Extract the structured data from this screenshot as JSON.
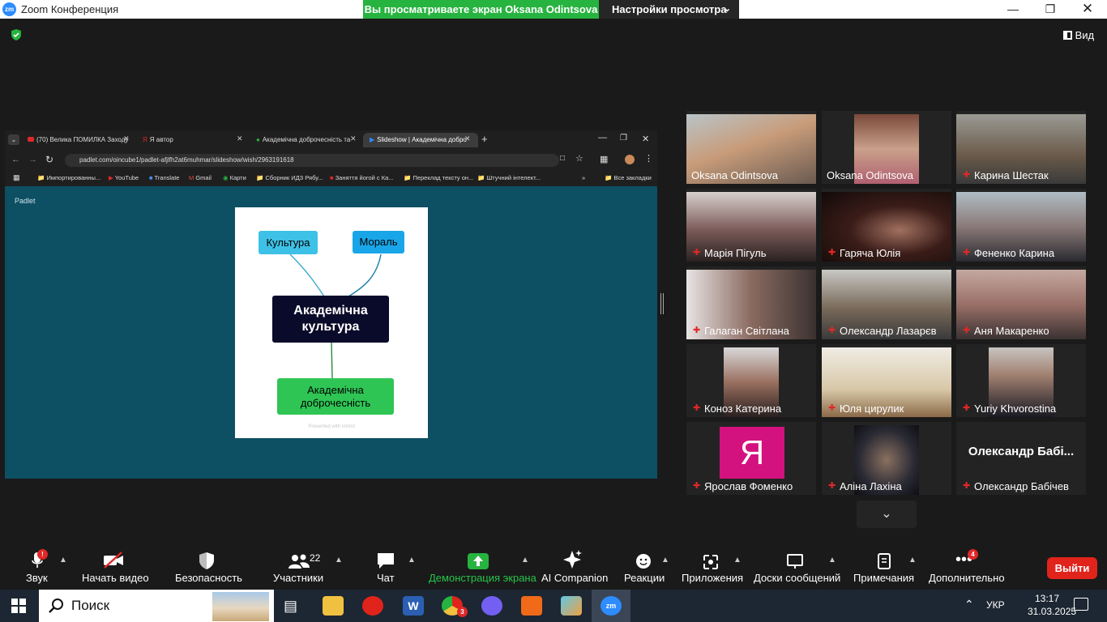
{
  "window": {
    "title": "Zoom Конференция",
    "logo": "zm",
    "share_banner": "Вы просматриваете экран Oksana Odintsova",
    "view_settings": "Настройки просмотра",
    "view_button": "Вид"
  },
  "browser": {
    "tabs": [
      {
        "label": "(70) Велика ПОМИЛКА Заходу",
        "active": false
      },
      {
        "label": "Я автор",
        "active": false
      },
      {
        "label": "Академічна доброчесність та",
        "active": false
      },
      {
        "label": "Slideshow | Академічна добро",
        "active": true
      }
    ],
    "url": "padlet.com/oincube1/padlet-afjlfh2at6muhmar/slideshow/wish/2963191618",
    "bookmarks": [
      "Импортированны...",
      "YouTube",
      "Translate",
      "Gmail",
      "Карти",
      "Сборник ИДЗ Рябу...",
      "Заняття йогой с Ка...",
      "Переклад тексту он...",
      "Штучний інтелект..."
    ],
    "all_bookmarks": "Все закладки"
  },
  "slide": {
    "app_label": "Padlet",
    "culture": "Культура",
    "moral": "Мораль",
    "center_line1": "Академічна",
    "center_line2": "культура",
    "bottom_line1": "Академічна",
    "bottom_line2": "доброчесність",
    "footer": "Presented with xmind"
  },
  "participants": [
    {
      "name": "Oksana Odintsova",
      "muted": false,
      "active": true
    },
    {
      "name": "Oksana Odintsova",
      "muted": false,
      "active": false
    },
    {
      "name": "Карина Шестак",
      "muted": true,
      "active": false
    },
    {
      "name": "Марія Пігуль",
      "muted": true,
      "active": false
    },
    {
      "name": "Гаряча Юлія",
      "muted": true,
      "active": false
    },
    {
      "name": "Фененко Карина",
      "muted": true,
      "active": false
    },
    {
      "name": "Галаган Світлана",
      "muted": true,
      "active": false
    },
    {
      "name": "Олександр Лазарєв",
      "muted": true,
      "active": false
    },
    {
      "name": "Аня Макаренко",
      "muted": true,
      "active": false
    },
    {
      "name": "Коноз Катерина",
      "muted": true,
      "active": false
    },
    {
      "name": "Юля цирулик",
      "muted": true,
      "active": false
    },
    {
      "name": "Yuriy Khvorostina",
      "muted": true,
      "active": false
    },
    {
      "name": "Ярослав Фоменко",
      "muted": true,
      "active": false,
      "avatar_letter": "Я"
    },
    {
      "name": "Аліна Лахіна",
      "muted": true,
      "active": false
    },
    {
      "name": "Олександр Бабічев",
      "muted": true,
      "active": false,
      "big_name": "Олександр Бабі..."
    }
  ],
  "toolbar": {
    "audio": "Звук",
    "video": "Начать видео",
    "security": "Безопасность",
    "participants": "Участники",
    "participants_count": "22",
    "chat": "Чат",
    "share": "Демонстрация экрана",
    "ai": "AI Companion",
    "reactions": "Реакции",
    "apps": "Приложения",
    "whiteboards": "Доски сообщений",
    "notes": "Примечания",
    "more": "Дополнительно",
    "more_badge": "4",
    "audio_badge": "!",
    "exit": "Выйти"
  },
  "taskbar": {
    "search": "Поиск",
    "lang": "УКР",
    "time": "13:17",
    "date": "31.03.2025",
    "chrome_badge": "3"
  },
  "colors": {
    "share_green": "#27b33f",
    "active_border": "#e8f06a",
    "slide_bg": "#0d4f63",
    "culture_box": "#3ec1e6",
    "moral_box": "#19a6e8",
    "center_box": "#0a0a2a",
    "bottom_box": "#2fc555",
    "exit_red": "#e0231b",
    "avatar_magenta": "#d3127f"
  }
}
